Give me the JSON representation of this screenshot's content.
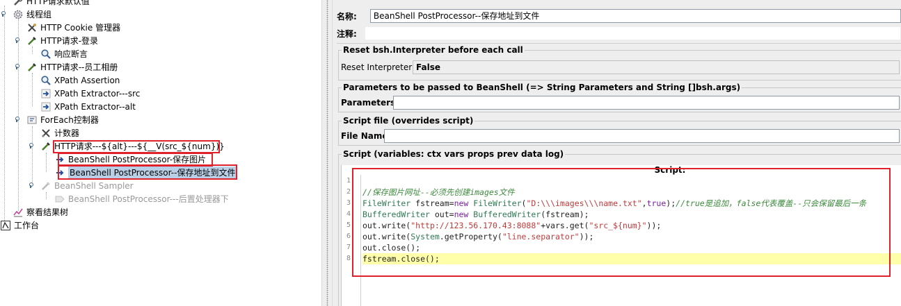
{
  "tree": {
    "items": [
      {
        "label": "HTTP请求默认值",
        "icon": "wrench-icon",
        "disabled": false,
        "selected": false
      },
      {
        "label": "线程组",
        "icon": "gear-icon",
        "disabled": false,
        "selected": false
      },
      {
        "label": "HTTP Cookie 管理器",
        "icon": "wrench-icon",
        "disabled": false,
        "selected": false
      },
      {
        "label": "HTTP请求-登录",
        "icon": "pipette-icon",
        "disabled": false,
        "selected": false
      },
      {
        "label": "响应断言",
        "icon": "magnifier-icon",
        "disabled": false,
        "selected": false
      },
      {
        "label": "HTTP请求--员工相册",
        "icon": "pipette-icon",
        "disabled": false,
        "selected": false
      },
      {
        "label": "XPath Assertion",
        "icon": "magnifier-icon",
        "disabled": false,
        "selected": false
      },
      {
        "label": "XPath Extractor---src",
        "icon": "extractor-icon",
        "disabled": false,
        "selected": false
      },
      {
        "label": "XPath Extractor--alt",
        "icon": "extractor-icon",
        "disabled": false,
        "selected": false
      },
      {
        "label": "ForEach控制器",
        "icon": "controller-icon",
        "disabled": false,
        "selected": false
      },
      {
        "label": "计数器",
        "icon": "scissors-icon",
        "disabled": false,
        "selected": false
      },
      {
        "label": "HTTP请求---${alt}---${__V(src_${num})}",
        "icon": "pipette-icon",
        "disabled": false,
        "selected": false
      },
      {
        "label": "BeanShell PostProcessor-保存图片",
        "icon": "extractor-icon",
        "disabled": false,
        "selected": false
      },
      {
        "label": "BeanShell PostProcessor--保存地址到文件",
        "icon": "extractor-icon",
        "disabled": false,
        "selected": true
      },
      {
        "label": "BeanShell Sampler",
        "icon": "pipette-icon",
        "disabled": true,
        "selected": false
      },
      {
        "label": "BeanShell PostProcessor---后置处理器下",
        "icon": "extractor-icon",
        "disabled": true,
        "selected": false
      },
      {
        "label": "察看结果树",
        "icon": "chart-icon",
        "disabled": false,
        "selected": false
      },
      {
        "label": "工作台",
        "icon": "workbench-icon",
        "disabled": false,
        "selected": false
      }
    ]
  },
  "form": {
    "name_label": "名称:",
    "name_value": "BeanShell PostProcessor--保存地址到文件",
    "comment_label": "注释:",
    "comment_value": "",
    "reset_group_title": "Reset bsh.Interpreter before each call",
    "reset_label": "Reset Interpreter:",
    "reset_value": "False",
    "params_group_title": "Parameters to be passed to BeanShell (=> String Parameters and String []bsh.args)",
    "params_label": "Parameters:",
    "params_value": "",
    "file_group_title": "Script file (overrides script)",
    "file_label": "File Name:",
    "file_value": "",
    "script_group_title": "Script (variables: ctx vars props prev data log)",
    "script_editor_title": "Script:"
  },
  "script": {
    "line_numbers": [
      "1",
      "2",
      "3",
      "4",
      "5",
      "6",
      "7",
      "8"
    ],
    "current_line": 8,
    "lines": [
      [],
      [
        {
          "t": "//保存图片网址--必须先创建images文件",
          "c": "comment"
        }
      ],
      [
        {
          "t": "FileWriter",
          "c": "type"
        },
        {
          "t": " fstream=",
          "c": "plain"
        },
        {
          "t": "new",
          "c": "kw"
        },
        {
          "t": " ",
          "c": "plain"
        },
        {
          "t": "FileWriter",
          "c": "type"
        },
        {
          "t": "(",
          "c": "plain"
        },
        {
          "t": "\"D:\\\\\\images\\\\\\name.txt\"",
          "c": "str"
        },
        {
          "t": ",",
          "c": "plain"
        },
        {
          "t": "true",
          "c": "kw"
        },
        {
          "t": ");",
          "c": "plain"
        },
        {
          "t": "//true是追加，false代表覆盖--只会保留最后一条",
          "c": "comment"
        }
      ],
      [
        {
          "t": "BufferedWriter",
          "c": "type"
        },
        {
          "t": " out=",
          "c": "plain"
        },
        {
          "t": "new",
          "c": "kw"
        },
        {
          "t": " ",
          "c": "plain"
        },
        {
          "t": "BufferedWriter",
          "c": "type"
        },
        {
          "t": "(fstream);",
          "c": "plain"
        }
      ],
      [
        {
          "t": "out.write(",
          "c": "plain"
        },
        {
          "t": "\"http://123.56.170.43:8088\"",
          "c": "str"
        },
        {
          "t": "+vars.get(",
          "c": "plain"
        },
        {
          "t": "\"src_${num}\"",
          "c": "str"
        },
        {
          "t": "));",
          "c": "plain"
        }
      ],
      [
        {
          "t": "out.write(",
          "c": "plain"
        },
        {
          "t": "System",
          "c": "type"
        },
        {
          "t": ".getProperty(",
          "c": "plain"
        },
        {
          "t": "\"line.separator\"",
          "c": "str"
        },
        {
          "t": "));",
          "c": "plain"
        }
      ],
      [
        {
          "t": "out.close();",
          "c": "plain"
        }
      ],
      [
        {
          "t": "fstream.close();",
          "c": "plain"
        }
      ]
    ]
  },
  "colors": {
    "highlight_box": "#e0202a",
    "selection": "#b8cfe5",
    "current_line": "#ffffaa"
  }
}
